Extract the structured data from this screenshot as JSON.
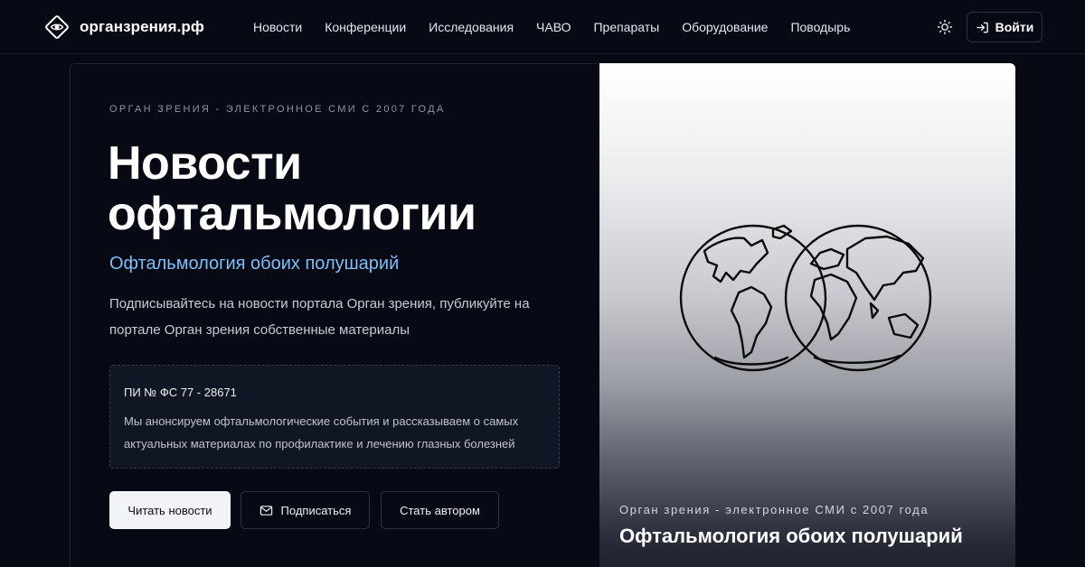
{
  "header": {
    "brand": "органзрения.рф",
    "nav": [
      "Новости",
      "Конференции",
      "Исследования",
      "ЧАВО",
      "Препараты",
      "Оборудование",
      "Поводырь"
    ],
    "theme_icon": "sun-icon",
    "login_label": "Войти",
    "login_icon": "log-in-icon"
  },
  "hero": {
    "eyebrow": "ОРГАН ЗРЕНИЯ - ЭЛЕКТРОННОЕ СМИ С 2007 ГОДА",
    "title": "Новости офтальмологии",
    "subtitle": "Офтальмология обоих полушарий",
    "lead": "Подписывайтесь на новости портала Орган зрения, публикуйте на портале Орган зрения собственные материалы",
    "info_title": "ПИ № ФС 77 - 28671",
    "info_text": "Мы анонсируем офтальмологические события и рассказываем о самых актуальных материалах по профилактике и лечению глазных болезней",
    "buttons": {
      "read": "Читать новости",
      "subscribe": "Подписаться",
      "subscribe_icon": "mail-icon",
      "author": "Стать автором"
    }
  },
  "image_card": {
    "image_icon": "world-hemispheres-icon",
    "eyebrow": "Орган зрения - электронное СМИ с 2007 года",
    "title": "Офтальмология обоих полушарий"
  },
  "colors": {
    "background": "#070914",
    "accent": "#7fbff7",
    "primary_button": "#f1f3f7"
  }
}
